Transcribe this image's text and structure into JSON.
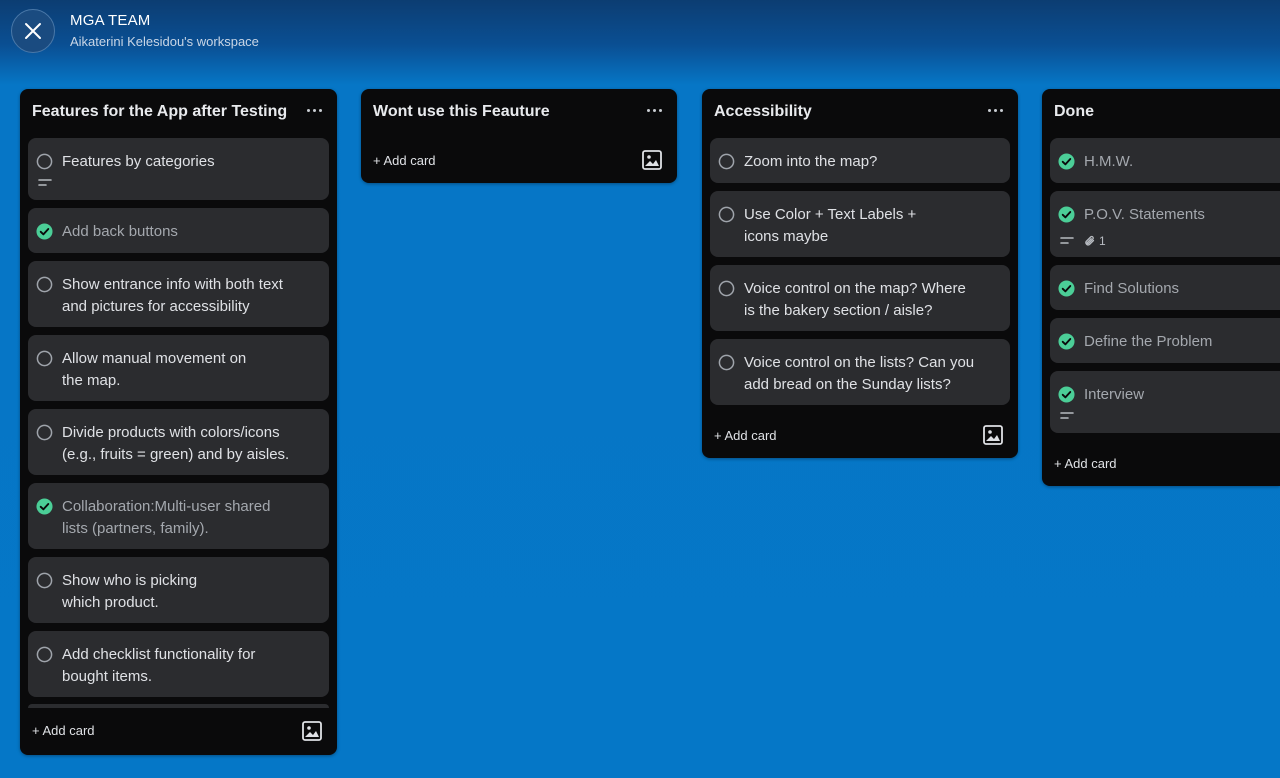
{
  "header": {
    "team_name": "MGA TEAM",
    "workspace": "Aikaterini Kelesidou's workspace"
  },
  "lists": [
    {
      "title": "Features for the App after Testing",
      "add_card": "+ Add card",
      "cards": [
        {
          "text": "Features by categories",
          "done": false,
          "has_description": true
        },
        {
          "text": "Add back buttons",
          "done": true
        },
        {
          "text": "Show entrance info with both text\nand pictures for accessibility",
          "done": false
        },
        {
          "text": "Allow manual movement on\nthe map.",
          "done": false
        },
        {
          "text": "Divide products with colors/icons\n(e.g., fruits = green) and by aisles.",
          "done": false
        },
        {
          "text": "Collaboration:Multi-user shared\nlists (partners, family).",
          "done": true
        },
        {
          "text": "Show who is picking\nwhich product.",
          "done": false
        },
        {
          "text": "Add checklist functionality for\nbought items.",
          "done": false
        }
      ]
    },
    {
      "title": "Wont use this Feauture",
      "add_card": "+ Add card",
      "cards": []
    },
    {
      "title": "Accessibility",
      "add_card": "+ Add card",
      "cards": [
        {
          "text": "Zoom into the map?",
          "done": false
        },
        {
          "text": "Use Color + Text Labels  +\nicons maybe",
          "done": false
        },
        {
          "text": "Voice control on the map? Where\nis the bakery section / aisle?",
          "done": false
        },
        {
          "text": "Voice control on the lists? Can you\nadd bread on the Sunday lists?",
          "done": false
        }
      ]
    },
    {
      "title": "Done",
      "add_card": "+ Add card",
      "cards": [
        {
          "text": "H.M.W.",
          "done": true
        },
        {
          "text": "P.O.V. Statements",
          "done": true,
          "has_description": true,
          "attachments": "1"
        },
        {
          "text": "Find Solutions",
          "done": true
        },
        {
          "text": "Define the Problem",
          "done": true
        },
        {
          "text": "Interview",
          "done": true,
          "has_description": true
        }
      ]
    }
  ],
  "colors": {
    "done_check": "#4bce97",
    "list_bg": "#0a0a0b",
    "card_bg": "#2b2c2f",
    "board_bg": "#0577c7"
  },
  "icons": {
    "close": "close-icon",
    "menu": "ellipsis-icon",
    "template": "image-icon",
    "check_done": "check-circle-icon",
    "check_open": "circle-icon",
    "description": "description-icon",
    "attachment": "paperclip-icon"
  }
}
